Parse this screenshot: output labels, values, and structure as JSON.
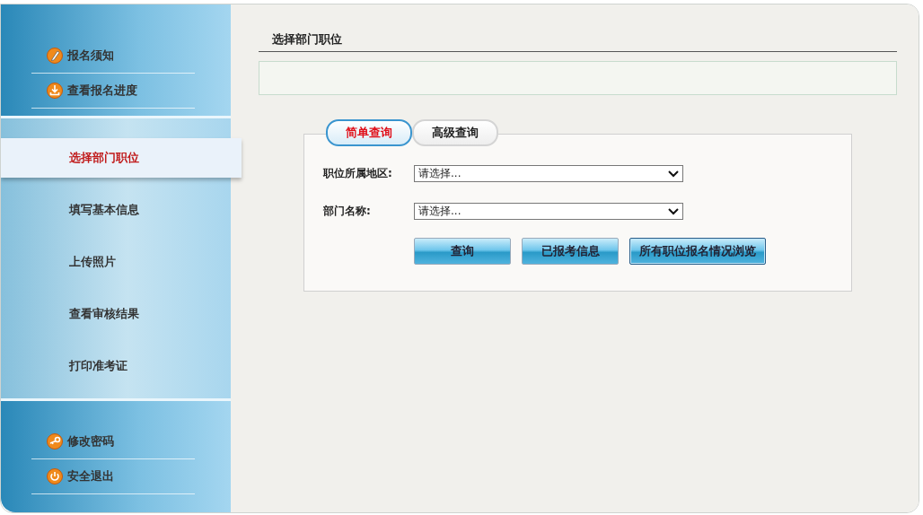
{
  "sidebar": {
    "top_links": [
      {
        "label": "报名须知"
      },
      {
        "label": "查看报名进度"
      }
    ],
    "steps": [
      {
        "label": "选择部门职位",
        "selected": true
      },
      {
        "label": "填写基本信息",
        "selected": false
      },
      {
        "label": "上传照片",
        "selected": false
      },
      {
        "label": "查看审核结果",
        "selected": false
      },
      {
        "label": "打印准考证",
        "selected": false
      }
    ],
    "bottom_links": [
      {
        "label": "修改密码"
      },
      {
        "label": "安全退出"
      }
    ]
  },
  "main": {
    "title": "选择部门职位",
    "tabs": [
      {
        "label": "简单查询",
        "selected": true
      },
      {
        "label": "高级查询",
        "selected": false
      }
    ],
    "fields": [
      {
        "label": "职位所属地区:",
        "value": "请选择..."
      },
      {
        "label": "部门名称:",
        "value": "请选择..."
      }
    ],
    "buttons": [
      {
        "label": "查询",
        "focused": false
      },
      {
        "label": "已报考信息",
        "focused": false
      },
      {
        "label": "所有职位报名情况浏览",
        "focused": true
      }
    ]
  }
}
